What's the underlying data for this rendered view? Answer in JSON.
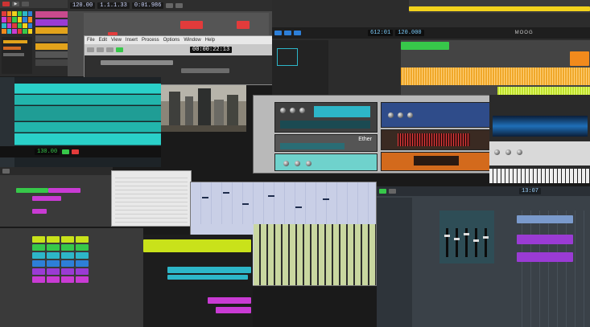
{
  "lcd": {
    "tempo_a": "120.00",
    "position_a": "1.1.1.33",
    "time_a": "0:01.986",
    "timecode": "00:00:22:13",
    "counter_left": "612:01",
    "tempo_b": "120.000",
    "tempo_c": "130.00",
    "counter_right": "13:07"
  },
  "labels": {
    "synth_brand": "Ether",
    "right_logo": "MOOG"
  },
  "menu": [
    "File",
    "Edit",
    "View",
    "Insert",
    "Process",
    "Options",
    "Window",
    "Help"
  ],
  "colors": {
    "accent_green": "#37c84a",
    "accent_orange": "#f28a1c",
    "accent_blue": "#2d7fd8",
    "accent_magenta": "#c93bd4",
    "accent_lime": "#c9e21a",
    "accent_red": "#e23b3b"
  }
}
